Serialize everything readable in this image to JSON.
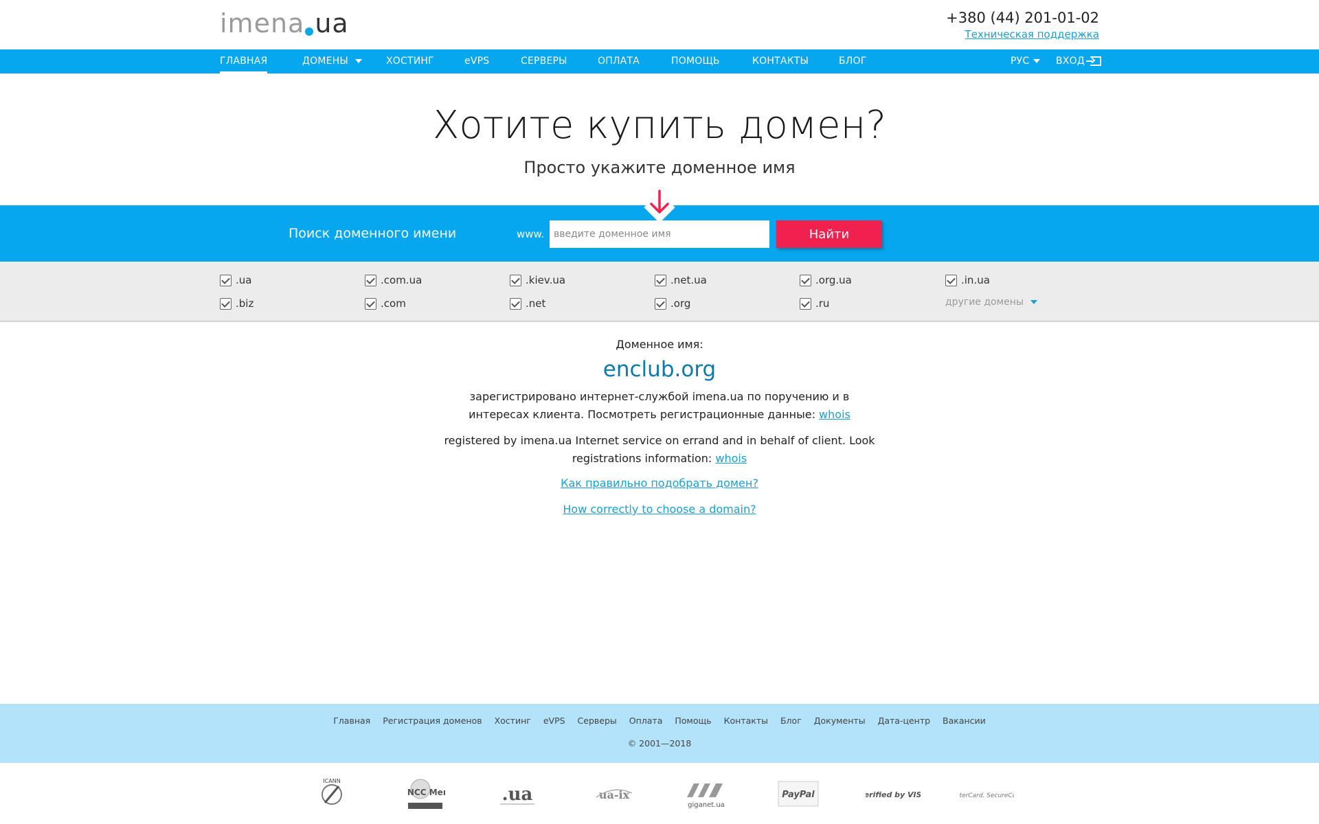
{
  "header": {
    "logo_main": "imena",
    "logo_suffix": "ua",
    "phone": "+380 (44) 201-01-02",
    "support_link": "Техническая поддержка"
  },
  "nav": {
    "items": [
      "ГЛАВНАЯ",
      "ДОМЕНЫ",
      "ХОСТИНГ",
      "eVPS",
      "СЕРВЕРЫ",
      "ОПЛАТА",
      "ПОМОЩЬ",
      "КОНТАКТЫ",
      "БЛОГ"
    ],
    "lang": "РУС",
    "login": "ВХОД"
  },
  "hero": {
    "title": "Хотите купить домен?",
    "subtitle": "Просто укажите доменное имя"
  },
  "search": {
    "label": "Поиск доменного имени",
    "prefix": "www.",
    "placeholder": "введите доменное имя",
    "button": "Найти"
  },
  "tlds": {
    "row1": [
      ".ua",
      ".com.ua",
      ".kiev.ua",
      ".net.ua",
      ".org.ua",
      ".in.ua"
    ],
    "row2": [
      ".biz",
      ".com",
      ".net",
      ".org",
      ".ru"
    ],
    "more": "другие домены"
  },
  "info": {
    "label": "Доменное имя:",
    "domain": "enclub.org",
    "ru_text": "зарегистрировано интернет-службой imena.ua по поручению и в интересах клиента. Посмотреть регистрационные данные: ",
    "ru_whois": "whois",
    "en_text": "registered by imena.ua Internet service on errand and in behalf of client. Look registrations information: ",
    "en_whois": "whois",
    "ru_howto": "Как правильно подобрать домен?",
    "en_howto": "How correctly to choose a domain?"
  },
  "footer": {
    "links": [
      "Главная",
      "Регистрация доменов",
      "Хостинг",
      "eVPS",
      "Серверы",
      "Оплата",
      "Помощь",
      "Контакты",
      "Блог",
      "Документы",
      "Дата-центр",
      "Вакансии"
    ],
    "copyright": "© 2001—2018"
  },
  "partners": [
    "ICANN",
    "RIPE NCC Member",
    ".ua",
    "ua-ix",
    "giganet.ua",
    "PayPal",
    "Verified by VISA",
    "MasterCard. SecureCode."
  ],
  "colors": {
    "brand_blue": "#06a7ee",
    "accent_red": "#f0214f",
    "link": "#1aa0d8",
    "domain": "#0b7bae",
    "footer_bg": "#b2e3fa"
  }
}
